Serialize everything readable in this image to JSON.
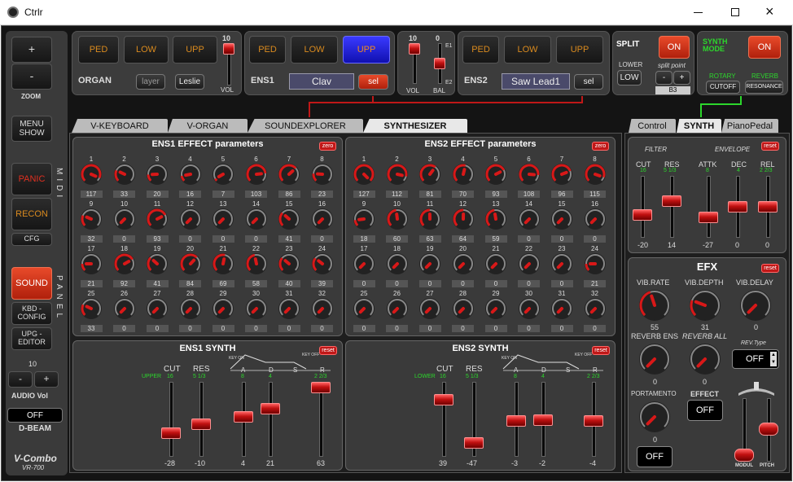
{
  "window": {
    "title": "Ctrlr",
    "icon": "ctrlr-logo-icon"
  },
  "left": {
    "zoom_plus": "+",
    "zoom_minus": "-",
    "zoom_label": "ZOOM",
    "menu_show": "MENU SHOW",
    "panic": "PANIC",
    "recon": "RECON",
    "cfg": "CFG",
    "midi_label": "MIDI",
    "sound": "SOUND",
    "kbd_config": "KBD - CONFIG",
    "upg_editor": "UPG - EDITOR",
    "panel_label": "PANEL",
    "audio_value": "10",
    "audio_minus": "-",
    "audio_plus": "+",
    "audio_label": "AUDIO Vol",
    "dbeam_value": "OFF",
    "dbeam_label": "D-BEAM",
    "brand": "V-Combo",
    "model": "VR-700"
  },
  "organ": {
    "ped": "PED",
    "low": "LOW",
    "upp": "UPP",
    "name": "ORGAN",
    "layer": "layer",
    "leslie": "Leslie",
    "vol_value": "10",
    "vol_label": "VOL",
    "vol_level": 1.0
  },
  "ens1top": {
    "ped": "PED",
    "low": "LOW",
    "upp": "UPP",
    "name": "ENS1",
    "patch": "Clav",
    "sel": "sel"
  },
  "mixer": {
    "vol_value": "10",
    "bal_value": "0",
    "vol_label": "VOL",
    "bal_label": "BAL",
    "e1": "E1",
    "e2": "E2",
    "vol_level": 1.0,
    "bal_level": 0.5
  },
  "ens2top": {
    "ped": "PED",
    "low": "LOW",
    "upp": "UPP",
    "name": "ENS2",
    "patch": "Saw Lead1",
    "sel": "sel"
  },
  "split": {
    "title": "SPLIT",
    "on": "ON",
    "lower_label": "LOWER",
    "low": "LOW",
    "point_label": "split point",
    "minus": "-",
    "plus": "+",
    "point": "B3"
  },
  "synthmode": {
    "title": "SYNTH MODE",
    "on": "ON",
    "rotary": "ROTARY",
    "reverb": "REVERB",
    "cutoff": "CUTOFF",
    "resonance": "RESONANCE"
  },
  "tabs": [
    {
      "label": "V-KEYBOARD"
    },
    {
      "label": "V-ORGAN"
    },
    {
      "label": "SOUNDEXPLORER"
    },
    {
      "label": "SYNTHESIZER"
    }
  ],
  "rtabs": [
    {
      "label": "Control"
    },
    {
      "label": "SYNTH"
    },
    {
      "label": "PianoPedal"
    }
  ],
  "ens1fx": {
    "title": "ENS1 EFFECT parameters",
    "zero": "zero",
    "knobs": [
      {
        "n": "1",
        "v": "117"
      },
      {
        "n": "2",
        "v": "33"
      },
      {
        "n": "3",
        "v": "20"
      },
      {
        "n": "4",
        "v": "16"
      },
      {
        "n": "5",
        "v": "7"
      },
      {
        "n": "6",
        "v": "103"
      },
      {
        "n": "7",
        "v": "86"
      },
      {
        "n": "8",
        "v": "23"
      },
      {
        "n": "9",
        "v": "32"
      },
      {
        "n": "10",
        "v": "0"
      },
      {
        "n": "11",
        "v": "93"
      },
      {
        "n": "12",
        "v": "0"
      },
      {
        "n": "13",
        "v": "0"
      },
      {
        "n": "14",
        "v": "0"
      },
      {
        "n": "15",
        "v": "41"
      },
      {
        "n": "16",
        "v": "0"
      },
      {
        "n": "17",
        "v": "21"
      },
      {
        "n": "18",
        "v": "92"
      },
      {
        "n": "19",
        "v": "41"
      },
      {
        "n": "20",
        "v": "84"
      },
      {
        "n": "21",
        "v": "69"
      },
      {
        "n": "22",
        "v": "58"
      },
      {
        "n": "23",
        "v": "40"
      },
      {
        "n": "24",
        "v": "39"
      },
      {
        "n": "25",
        "v": "33"
      },
      {
        "n": "26",
        "v": "0"
      },
      {
        "n": "27",
        "v": "0"
      },
      {
        "n": "28",
        "v": "0"
      },
      {
        "n": "29",
        "v": "0"
      },
      {
        "n": "30",
        "v": "0"
      },
      {
        "n": "31",
        "v": "0"
      },
      {
        "n": "32",
        "v": "0"
      }
    ]
  },
  "ens2fx": {
    "title": "ENS2 EFFECT parameters",
    "zero": "zero",
    "knobs": [
      {
        "n": "1",
        "v": "127"
      },
      {
        "n": "2",
        "v": "112"
      },
      {
        "n": "3",
        "v": "81"
      },
      {
        "n": "4",
        "v": "70"
      },
      {
        "n": "5",
        "v": "93"
      },
      {
        "n": "6",
        "v": "108"
      },
      {
        "n": "7",
        "v": "96"
      },
      {
        "n": "8",
        "v": "115"
      },
      {
        "n": "9",
        "v": "18"
      },
      {
        "n": "10",
        "v": "60"
      },
      {
        "n": "11",
        "v": "63"
      },
      {
        "n": "12",
        "v": "64"
      },
      {
        "n": "13",
        "v": "59"
      },
      {
        "n": "14",
        "v": "0"
      },
      {
        "n": "15",
        "v": "0"
      },
      {
        "n": "16",
        "v": "0"
      },
      {
        "n": "17",
        "v": "0"
      },
      {
        "n": "18",
        "v": "0"
      },
      {
        "n": "19",
        "v": "0"
      },
      {
        "n": "20",
        "v": "0"
      },
      {
        "n": "21",
        "v": "0"
      },
      {
        "n": "22",
        "v": "0"
      },
      {
        "n": "23",
        "v": "0"
      },
      {
        "n": "24",
        "v": "21"
      },
      {
        "n": "25",
        "v": "0"
      },
      {
        "n": "26",
        "v": "0"
      },
      {
        "n": "27",
        "v": "0"
      },
      {
        "n": "28",
        "v": "0"
      },
      {
        "n": "29",
        "v": "0"
      },
      {
        "n": "30",
        "v": "0"
      },
      {
        "n": "31",
        "v": "0"
      },
      {
        "n": "32",
        "v": "0"
      }
    ]
  },
  "ens1synth": {
    "title": "ENS1 SYNTH",
    "reset": "reset",
    "upper": "UPPER",
    "cut": "CUT",
    "cut_sub": "16",
    "res": "RES",
    "res_sub": "5 1/3",
    "a": "A",
    "a_sub": "8",
    "d": "D",
    "d_sub": "4",
    "s": "S",
    "r": "R",
    "r_sub": "2 2/3",
    "key_on": "KEY ON",
    "key_off": "KEY OFF",
    "values": {
      "cut": "-28",
      "res": "-10",
      "a": "4",
      "d": "21",
      "r": "63"
    }
  },
  "ens2synth": {
    "title": "ENS2 SYNTH",
    "reset": "reset",
    "lower": "LOWER",
    "cut": "CUT",
    "cut_sub": "16",
    "res": "RES",
    "res_sub": "5 1/3",
    "a": "A",
    "a_sub": "8",
    "d": "D",
    "d_sub": "4",
    "s": "S",
    "r": "R",
    "r_sub": "2 2/3",
    "key_on": "KEY ON",
    "key_off": "KEY OFF",
    "values": {
      "cut": "39",
      "res": "-47",
      "a": "-3",
      "d": "-2",
      "r": "-4"
    }
  },
  "filter": {
    "reset": "reset",
    "filter": "FILTER",
    "envelope": "ENVELOPE",
    "cut": "CUT",
    "cut_sub": "16",
    "res": "RES",
    "res_sub": "5 1/3",
    "attk": "ATTK",
    "attk_sub": "8",
    "dec": "DEC",
    "dec_sub": "4",
    "rel": "REL",
    "rel_sub": "2 2/3",
    "values": {
      "cut": "-20",
      "res": "14",
      "attk": "-27",
      "dec": "0",
      "rel": "0"
    }
  },
  "efx": {
    "title": "EFX",
    "reset": "reset",
    "vib_rate": "VIB.RATE",
    "vib_depth": "VIB.DEPTH",
    "vib_delay": "VIB.DELAY",
    "vib_rate_v": "55",
    "vib_depth_v": "31",
    "vib_delay_v": "0",
    "reverb_ens": "REVERB ENS",
    "reverb_all": "REVERB ALL",
    "rev_type": "REV.Type",
    "rev_type_v": "OFF",
    "reverb_ens_v": "0",
    "reverb_all_v": "0",
    "portamento": "PORTAMENTO",
    "portamento_v": "0",
    "effect": "EFFECT",
    "effect_btn": "OFF",
    "porta_btn": "OFF",
    "modul": "MODUL",
    "pitch": "PITCH"
  }
}
